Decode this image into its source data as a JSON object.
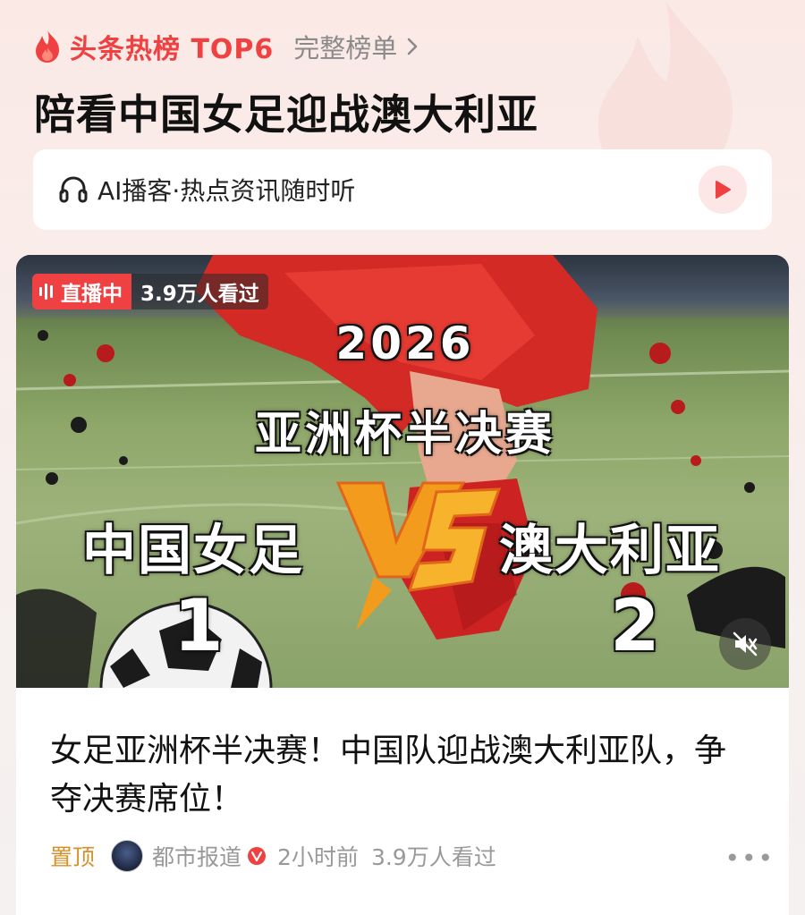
{
  "header": {
    "hot_label": "头条热榜 TOP6",
    "full_list_label": "完整榜单",
    "title": "陪看中国女足迎战澳大利亚"
  },
  "podcast": {
    "label": "AI播客·热点资讯随时听"
  },
  "card": {
    "live_label": "直播中",
    "views_badge": "3.9万人看过",
    "overlay": {
      "year": "2026",
      "event": "亚洲杯半决赛",
      "home_team": "中国女足",
      "away_team": "澳大利亚",
      "home_score": "1",
      "away_score": "2"
    },
    "headline": "女足亚洲杯半决赛！中国队迎战澳大利亚队，争夺决赛席位！",
    "meta": {
      "pinned": "置顶",
      "source": "都市报道",
      "time": "2小时前",
      "views": "3.9万人看过"
    }
  },
  "colors": {
    "accent": "#f04142",
    "pinned": "#d4912a",
    "muted_text": "#999999"
  },
  "icons": [
    "flame-icon",
    "chevron-right-icon",
    "headphone-icon",
    "play-icon",
    "live-bars-icon",
    "mute-icon",
    "verified-icon",
    "more-icon"
  ]
}
